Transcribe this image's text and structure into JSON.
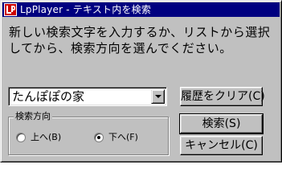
{
  "window": {
    "title": "LpPlayer - テキスト内を検索",
    "app_icon": "lp-logo-icon"
  },
  "instruction": "新しい検索文字を入力するか、リストから選択してから、検索方向を選んでください。",
  "search_combo": {
    "value": "たんぽぽの家",
    "dropdown_icon": "chevron-down-icon"
  },
  "direction_group": {
    "legend": "検索方向",
    "options": [
      {
        "label": "上へ(B)",
        "selected": false
      },
      {
        "label": "下へ(F)",
        "selected": true
      }
    ]
  },
  "buttons": {
    "clear_history": "履歴をクリア(C)",
    "search": "検索(S)",
    "cancel": "キャンセル(C)"
  },
  "colors": {
    "face": "#c0c0c0",
    "titlebar": "#000080",
    "icon_accent": "#cc0000"
  }
}
